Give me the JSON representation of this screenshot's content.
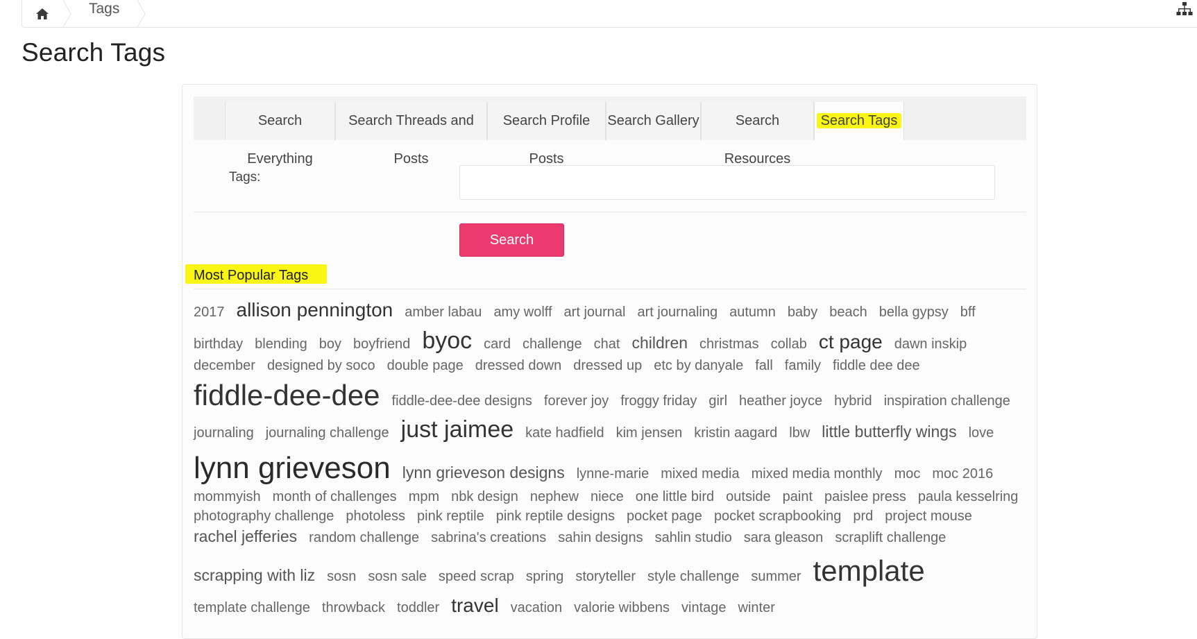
{
  "breadcrumb": {
    "home_icon": "home-icon",
    "current": "Tags",
    "sitemap_icon": "sitemap-icon"
  },
  "page_title": "Search Tags",
  "tabs": [
    {
      "label": "Search Everything",
      "active": false
    },
    {
      "label": "Search Threads and Posts",
      "active": false
    },
    {
      "label": "Search Profile Posts",
      "active": false
    },
    {
      "label": "Search Gallery",
      "active": false
    },
    {
      "label": "Search Resources",
      "active": false
    },
    {
      "label": "Search Tags",
      "active": true
    }
  ],
  "form": {
    "tags_label": "Tags:",
    "tags_value": "",
    "search_button": "Search"
  },
  "popular": {
    "heading": "Most Popular Tags",
    "rows": [
      [
        [
          "2017",
          1
        ],
        [
          "allison pennington",
          3
        ],
        [
          "amber labau",
          1
        ],
        [
          "amy wolff",
          1
        ],
        [
          "art journal",
          1
        ],
        [
          "art journaling",
          1
        ],
        [
          "autumn",
          1
        ],
        [
          "baby",
          1
        ],
        [
          "beach",
          1
        ],
        [
          "bella gypsy",
          1
        ],
        [
          "bff",
          1
        ]
      ],
      [
        [
          "birthday",
          1
        ],
        [
          "blending",
          1
        ],
        [
          "boy",
          1
        ],
        [
          "boyfriend",
          1
        ],
        [
          "byoc",
          4
        ],
        [
          "card",
          1
        ],
        [
          "challenge",
          1
        ],
        [
          "chat",
          1
        ],
        [
          "children",
          2
        ],
        [
          "christmas",
          1
        ],
        [
          "collab",
          1
        ],
        [
          "ct page",
          3
        ],
        [
          "dawn inskip",
          1
        ]
      ],
      [
        [
          "december",
          1
        ],
        [
          "designed by soco",
          1
        ],
        [
          "double page",
          1
        ],
        [
          "dressed down",
          1
        ],
        [
          "dressed up",
          1
        ],
        [
          "etc by danyale",
          1
        ],
        [
          "fall",
          1
        ],
        [
          "family",
          1
        ],
        [
          "fiddle dee dee",
          1
        ]
      ],
      [
        [
          "fiddle-dee-dee",
          5
        ],
        [
          "fiddle-dee-dee designs",
          1
        ],
        [
          "forever joy",
          1
        ],
        [
          "froggy friday",
          1
        ],
        [
          "girl",
          1
        ],
        [
          "heather joyce",
          1
        ],
        [
          "hybrid",
          1
        ],
        [
          "inspiration challenge",
          1
        ]
      ],
      [
        [
          "journaling",
          1
        ],
        [
          "journaling challenge",
          1
        ],
        [
          "just jaimee",
          4
        ],
        [
          "kate hadfield",
          1
        ],
        [
          "kim jensen",
          1
        ],
        [
          "kristin aagard",
          1
        ],
        [
          "lbw",
          1
        ],
        [
          "little butterfly wings",
          2
        ],
        [
          "love",
          1
        ]
      ],
      [
        [
          "lynn grieveson",
          6
        ],
        [
          "lynn grieveson designs",
          2
        ],
        [
          "lynne-marie",
          1
        ],
        [
          "mixed media",
          1
        ],
        [
          "mixed media monthly",
          1
        ],
        [
          "moc",
          1
        ],
        [
          "moc 2016",
          1
        ]
      ],
      [
        [
          "mommyish",
          1
        ],
        [
          "month of challenges",
          1
        ],
        [
          "mpm",
          1
        ],
        [
          "nbk design",
          1
        ],
        [
          "nephew",
          1
        ],
        [
          "niece",
          1
        ],
        [
          "one little bird",
          1
        ],
        [
          "outside",
          1
        ],
        [
          "paint",
          1
        ],
        [
          "paislee press",
          1
        ],
        [
          "paula kesselring",
          1
        ]
      ],
      [
        [
          "photography challenge",
          1
        ],
        [
          "photoless",
          1
        ],
        [
          "pink reptile",
          1
        ],
        [
          "pink reptile designs",
          1
        ],
        [
          "pocket page",
          1
        ],
        [
          "pocket scrapbooking",
          1
        ],
        [
          "prd",
          1
        ],
        [
          "project mouse",
          1
        ]
      ],
      [
        [
          "rachel jefferies",
          2
        ],
        [
          "random challenge",
          1
        ],
        [
          "sabrina's creations",
          1
        ],
        [
          "sahin designs",
          1
        ],
        [
          "sahlin studio",
          1
        ],
        [
          "sara gleason",
          1
        ],
        [
          "scraplift challenge",
          1
        ]
      ],
      [
        [
          "scrapping with liz",
          2
        ],
        [
          "sosn",
          1
        ],
        [
          "sosn sale",
          1
        ],
        [
          "speed scrap",
          1
        ],
        [
          "spring",
          1
        ],
        [
          "storyteller",
          1
        ],
        [
          "style challenge",
          1
        ],
        [
          "summer",
          1
        ],
        [
          "template",
          5
        ]
      ],
      [
        [
          "template challenge",
          1
        ],
        [
          "throwback",
          1
        ],
        [
          "toddler",
          1
        ],
        [
          "travel",
          3
        ],
        [
          "vacation",
          1
        ],
        [
          "valorie wibbens",
          1
        ],
        [
          "vintage",
          1
        ],
        [
          "winter",
          1
        ]
      ]
    ]
  },
  "colors": {
    "accent_button": "#ea3a6e",
    "highlight": "#f9f514"
  }
}
